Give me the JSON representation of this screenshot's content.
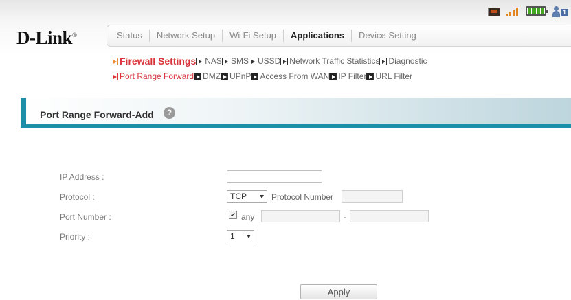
{
  "brand": {
    "logo": "D-Link",
    "trademark": "®"
  },
  "status_bar": {
    "icons": [
      "sim-icon",
      "signal-icon",
      "battery-icon",
      "user-icon"
    ],
    "connected_users": "1"
  },
  "tabs": [
    {
      "label": "Status",
      "active": false
    },
    {
      "label": "Network Setup",
      "active": false
    },
    {
      "label": "Wi-Fi Setup",
      "active": false
    },
    {
      "label": "Applications",
      "active": true
    },
    {
      "label": "Device Setting",
      "active": false
    }
  ],
  "submenu": {
    "row1": [
      "Firewall Settings",
      "NAS",
      "SMS",
      "USSD",
      "Network Traffic Statistics",
      "Diagnostic"
    ],
    "row2": [
      "Port Range Forward",
      "DMZ",
      "UPnP",
      "Access From WAN",
      "IP Filter",
      "URL Filter"
    ]
  },
  "page": {
    "title": "Port Range Forward-Add",
    "help": "?"
  },
  "form": {
    "ip_address_label": "IP Address :",
    "ip_address_value": "",
    "protocol_label": "Protocol :",
    "protocol_value": "TCP",
    "protocol_number_label": "Protocol Number",
    "protocol_number_value": "",
    "port_number_label": "Port Number :",
    "port_any_checked": true,
    "port_any_label": "any",
    "port_separator": "-",
    "port_from": "",
    "port_to": "",
    "priority_label": "Priority :",
    "priority_value": "1"
  },
  "apply_label": "Apply",
  "colors": {
    "accent_teal": "#1e8fa8",
    "active_red": "#d9353d",
    "section_orange": "#e79235",
    "battery_green": "#3ea51d"
  }
}
